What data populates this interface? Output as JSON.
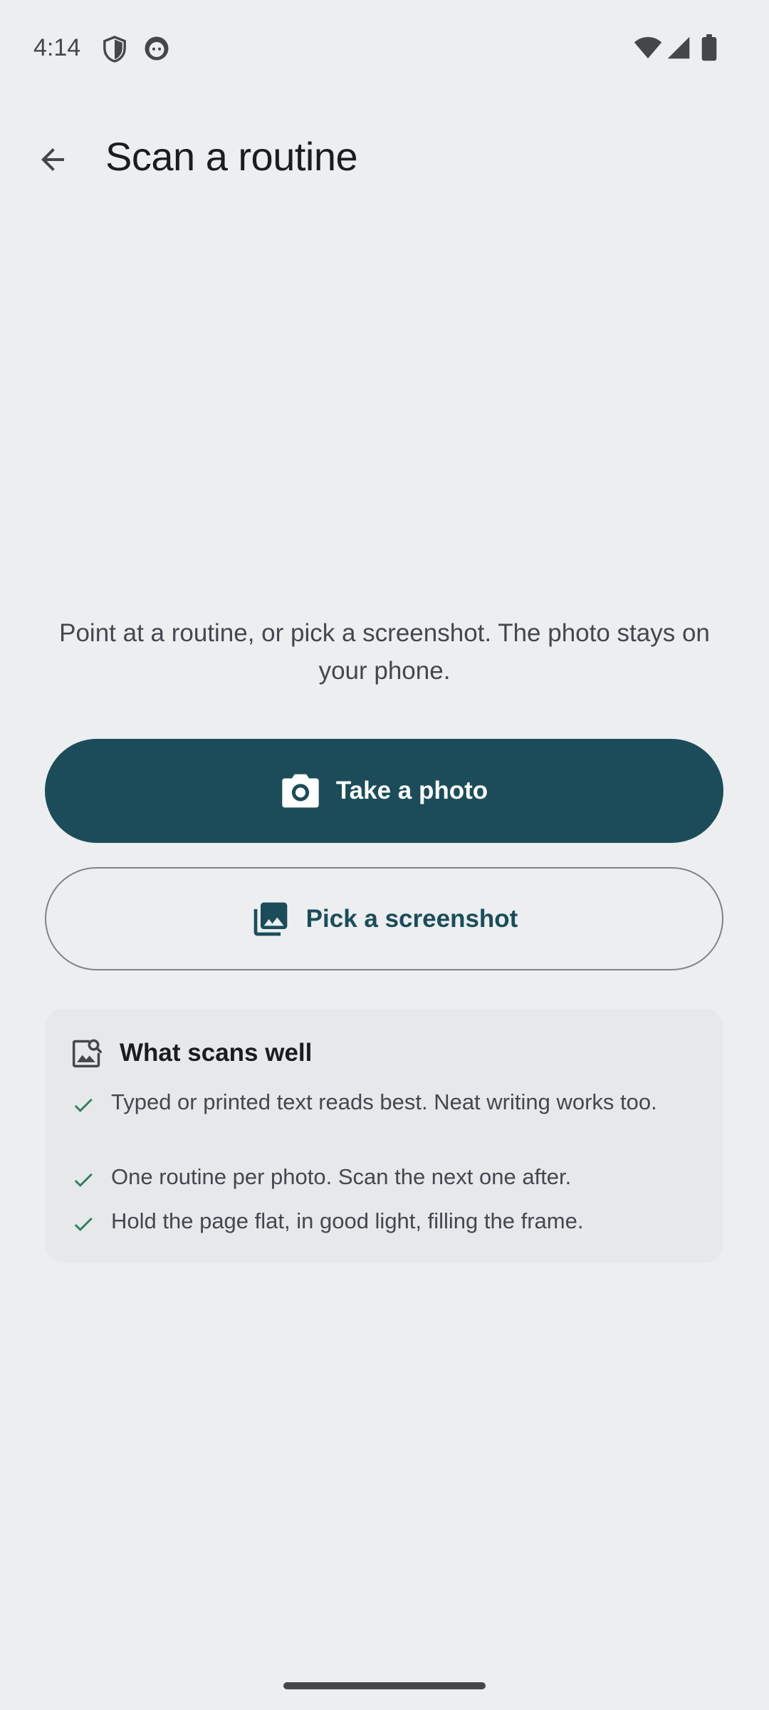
{
  "status_bar": {
    "time": "4:14",
    "icons": [
      "shield-icon",
      "app-notification-icon",
      "wifi-icon",
      "cellular-signal-icon",
      "battery-icon"
    ]
  },
  "app_bar": {
    "back_icon": "arrow-back-icon",
    "title": "Scan a routine"
  },
  "intro_text": "Point at a routine, or pick a screenshot. The photo stays on your phone.",
  "actions": {
    "take_photo": {
      "label": "Take a photo",
      "icon": "camera-icon"
    },
    "pick_screenshot": {
      "label": "Pick a screenshot",
      "icon": "photo-library-icon"
    }
  },
  "tips": {
    "icon": "image-search-icon",
    "title": "What scans well",
    "items": [
      "Typed or printed text reads best. Neat writing works too.",
      "One routine per photo. Scan the next one after.",
      "Hold the page flat, in good light, filling the frame."
    ]
  },
  "colors": {
    "background": "#eceef0",
    "primary": "#1c4c5a",
    "check": "#2e7d5b"
  }
}
